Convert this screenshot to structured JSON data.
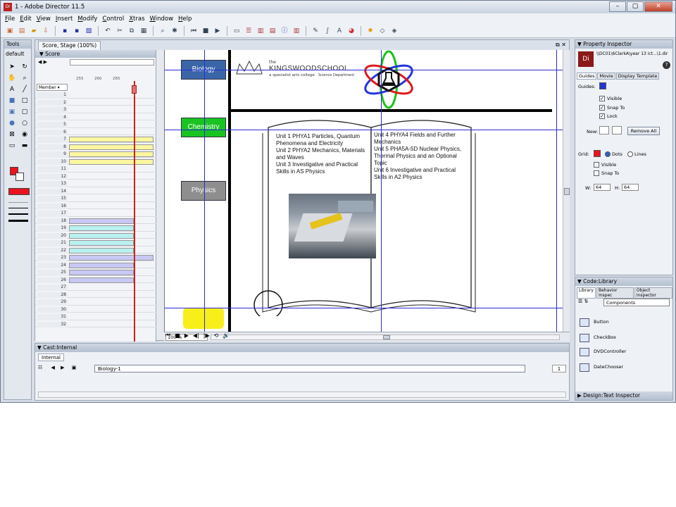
{
  "window": {
    "title": "1 - Adobe Director 11.5",
    "controls": [
      "–",
      "▢",
      "✕"
    ]
  },
  "menu": [
    "File",
    "Edit",
    "View",
    "Insert",
    "Modify",
    "Control",
    "Xtras",
    "Window",
    "Help"
  ],
  "tools_panel": {
    "title": "Tools",
    "preset": "default"
  },
  "score_window": {
    "tab": "Score, Stage (100%)",
    "score_title": "Score",
    "member_label": "Member",
    "frame_ticks": [
      "255",
      "260",
      "265"
    ],
    "channels": [
      "1",
      "2",
      "3",
      "4",
      "5",
      "6",
      "7",
      "8",
      "9",
      "10",
      "11",
      "12",
      "13",
      "14",
      "15",
      "16",
      "17",
      "18",
      "19",
      "20",
      "21",
      "22",
      "23",
      "24",
      "25",
      "26",
      "27",
      "28",
      "29",
      "30",
      "31",
      "32"
    ],
    "zoom": "100 %"
  },
  "stage": {
    "buttons": [
      {
        "label": "Biology",
        "color": "#3a66a8"
      },
      {
        "label": "Chemistry",
        "color": "#19c421"
      },
      {
        "label": "Physics",
        "color": "#8e8e8e"
      }
    ],
    "logo": {
      "the": "the",
      "name": "KINGSWOODSCHOOL",
      "tagline": "a specialist arts college",
      "dept": "Science Department"
    },
    "book_left": [
      "Unit 1 PHYA1 Particles, Quantum",
      "Phenomena and Electricity",
      "Unit 2 PHYA2 Mechanics, Materials",
      "and Waves",
      "Unit 3 Investigative and Practical",
      "Skills in AS Physics"
    ],
    "book_right": [
      "Unit 4 PHYA4 Fields and Further",
      "Mechanics",
      "Unit 5 PHA5A-5D Nuclear Physics,",
      "Thermal Physics and an Optional",
      "Topic",
      "Unit 6 Investigative and Practical",
      "Skills in A2 Physics"
    ]
  },
  "cast": {
    "title": "Cast:Internal",
    "tab": "Internal",
    "member_name": "Biology-1",
    "member_number": "1"
  },
  "property_inspector": {
    "title": "Property Inspector",
    "path": "\\\\DC01\\6ClarkA\\year 13 ict...\\1.dir",
    "tabs": [
      "Guides",
      "Movie",
      "Display Template"
    ],
    "guides_label": "Guides:",
    "checks": [
      {
        "label": "Visible",
        "checked": true
      },
      {
        "label": "Snap To",
        "checked": true
      },
      {
        "label": "Lock",
        "checked": true
      }
    ],
    "new_label": "New:",
    "remove_all": "Remove All",
    "grid_label": "Grid:",
    "grid_options": [
      "Dots",
      "Lines"
    ],
    "grid_checks": [
      {
        "label": "Visible",
        "checked": false
      },
      {
        "label": "Snap To",
        "checked": false
      }
    ],
    "w_label": "W:",
    "w_value": "64",
    "h_label": "H:",
    "h_value": "64"
  },
  "library": {
    "title": "Code:Library",
    "tabs": [
      "Library",
      "Behavior Inspec",
      "Object Inspector"
    ],
    "category": "Components",
    "items": [
      "Button",
      "CheckBox",
      "DVDController",
      "DateChooser"
    ],
    "footer": "Design:Text Inspector"
  },
  "colors": {
    "guide": "#2b2bd6",
    "accent_red": "#e8141e"
  }
}
